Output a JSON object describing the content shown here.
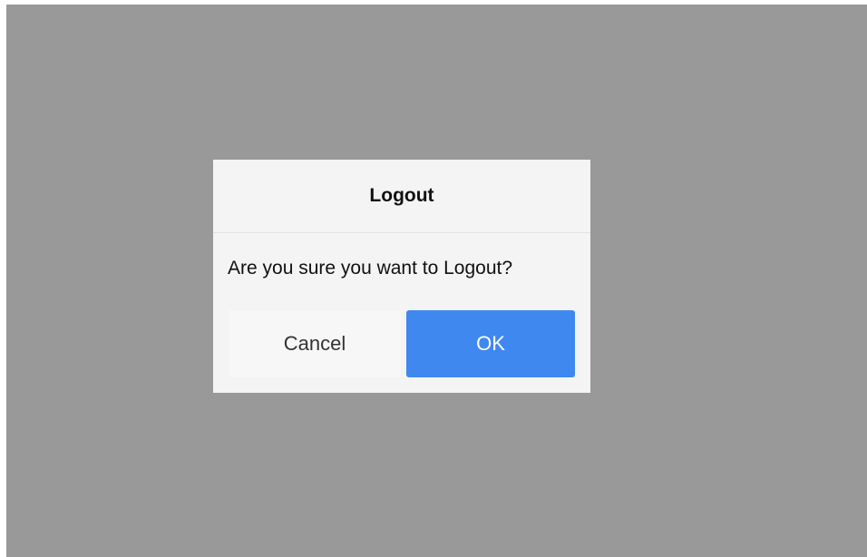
{
  "dialog": {
    "title": "Logout",
    "message": "Are you sure you want to Logout?",
    "cancel_label": "Cancel",
    "ok_label": "OK"
  },
  "colors": {
    "overlay": "#999999",
    "dialog_background": "#f4f4f4",
    "primary": "#3f88f0"
  }
}
